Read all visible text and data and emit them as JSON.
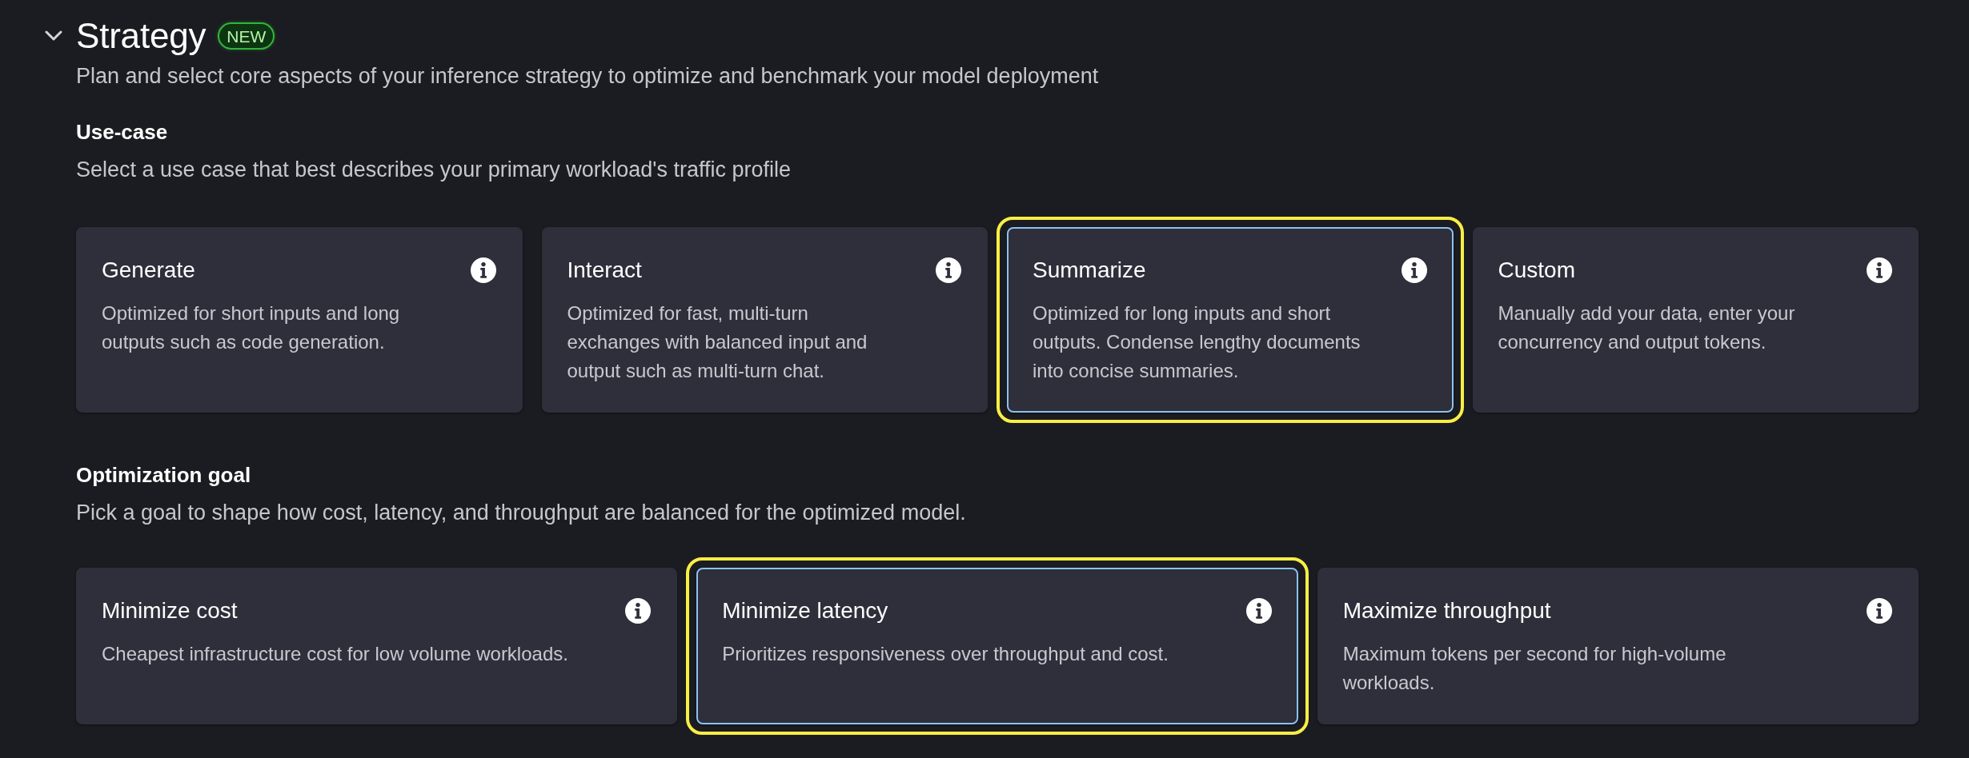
{
  "section": {
    "title": "Strategy",
    "badge": "NEW",
    "expanded": true,
    "description": "Plan and select core aspects of your inference strategy to optimize and benchmark your model deployment"
  },
  "use_case": {
    "heading": "Use-case",
    "description": "Select a use case that best describes your primary workload's traffic profile",
    "cards": [
      {
        "title": "Generate",
        "description": "Optimized for short inputs and long outputs such as code generation.",
        "selected": false
      },
      {
        "title": "Interact",
        "description": "Optimized for fast, multi-turn exchanges with balanced input and output such as multi-turn chat.",
        "selected": false
      },
      {
        "title": "Summarize",
        "description": "Optimized for long inputs and short outputs. Condense lengthy documents into concise summaries.",
        "selected": true
      },
      {
        "title": "Custom",
        "description": "Manually add your data, enter your concurrency and output tokens.",
        "selected": false
      }
    ]
  },
  "optimization_goal": {
    "heading": "Optimization goal",
    "description": "Pick a goal to shape how cost, latency, and throughput are balanced for the optimized model.",
    "cards": [
      {
        "title": "Minimize cost",
        "description": "Cheapest infrastructure cost for low volume workloads.",
        "selected": false
      },
      {
        "title": "Minimize latency",
        "description": "Prioritizes responsiveness over throughput and cost.",
        "selected": true
      },
      {
        "title": "Maximize throughput",
        "description": "Maximum tokens per second for high-volume workloads.",
        "selected": false
      }
    ]
  }
}
